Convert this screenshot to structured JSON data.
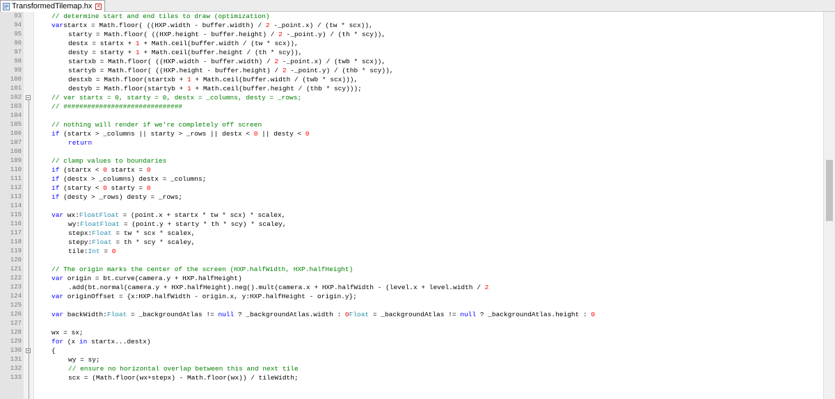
{
  "tab": {
    "filename": "TransformedTilemap.hx"
  },
  "lines": [
    {
      "n": "93",
      "i": 2,
      "t": [
        [
          "c",
          "// determine start and end tiles to draw (optimization)"
        ]
      ]
    },
    {
      "n": "94",
      "i": 2,
      "t": [
        [
          "k",
          "var"
        ],
        [
          "",
          "startx = Math.floor( ((HXP.width - buffer.width) / "
        ],
        [
          "n",
          "2"
        ],
        [
          "",
          " -_point.x) / (tw * scx)),"
        ]
      ]
    },
    {
      "n": "95",
      "i": 3,
      "t": [
        [
          "",
          "starty = Math.floor( ((HXP.height - buffer.height) / "
        ],
        [
          "n",
          "2"
        ],
        [
          "",
          " -_point.y) / (th * scy)),"
        ]
      ]
    },
    {
      "n": "96",
      "i": 3,
      "t": [
        [
          "",
          "destx = startx + "
        ],
        [
          "n",
          "1"
        ],
        [
          "",
          " + Math.ceil(buffer.width / (tw * scx)),"
        ]
      ]
    },
    {
      "n": "97",
      "i": 3,
      "t": [
        [
          "",
          "desty = starty + "
        ],
        [
          "n",
          "1"
        ],
        [
          "",
          " + Math.ceil(buffer.height / (th * scy)),"
        ]
      ]
    },
    {
      "n": "98",
      "i": 3,
      "t": [
        [
          "",
          "startxb = Math.floor( ((HXP.width - buffer.width) / "
        ],
        [
          "n",
          "2"
        ],
        [
          "",
          " -_point.x) / (twb * scx)),"
        ]
      ]
    },
    {
      "n": "99",
      "i": 3,
      "t": [
        [
          "",
          "startyb = Math.floor( ((HXP.height - buffer.height) / "
        ],
        [
          "n",
          "2"
        ],
        [
          "",
          " -_point.y) / (thb * scy)),"
        ]
      ]
    },
    {
      "n": "100",
      "i": 3,
      "t": [
        [
          "",
          "destxb = Math.floor(startxb + "
        ],
        [
          "n",
          "1"
        ],
        [
          "",
          " + Math.ceil(buffer.width / (twb * scx))),"
        ]
      ]
    },
    {
      "n": "101",
      "i": 3,
      "t": [
        [
          "",
          "destyb = Math.floor(startyb + "
        ],
        [
          "n",
          "1"
        ],
        [
          "",
          " + Math.ceil(buffer.height / (thb * scy)));"
        ]
      ]
    },
    {
      "n": "102",
      "i": 2,
      "t": [
        [
          "c",
          "// var startx = 0, starty = 0, destx = _columns, desty = _rows;"
        ]
      ]
    },
    {
      "n": "103",
      "i": 2,
      "t": [
        [
          "c",
          "// ##############################"
        ]
      ]
    },
    {
      "n": "104",
      "i": 0,
      "t": []
    },
    {
      "n": "105",
      "i": 2,
      "t": [
        [
          "c",
          "// nothing will render if we're completely off screen"
        ]
      ]
    },
    {
      "n": "106",
      "i": 2,
      "t": [
        [
          "k",
          "if"
        ],
        [
          "",
          " (startx > _columns || starty > _rows || destx < "
        ],
        [
          "n",
          "0"
        ],
        [
          "",
          " || desty < "
        ],
        [
          "n",
          "0"
        ],
        [
          ")"
        ]
      ]
    },
    {
      "n": "107",
      "i": 3,
      "t": [
        [
          "k",
          "return"
        ],
        [
          ";"
        ]
      ]
    },
    {
      "n": "108",
      "i": 0,
      "t": []
    },
    {
      "n": "109",
      "i": 2,
      "t": [
        [
          "c",
          "// clamp values to boundaries"
        ]
      ]
    },
    {
      "n": "110",
      "i": 2,
      "t": [
        [
          "k",
          "if"
        ],
        [
          "",
          " (startx < "
        ],
        [
          "n",
          "0"
        ],
        [
          "",
          " startx = "
        ],
        [
          "n",
          "0"
        ],
        [
          ";"
        ]
      ]
    },
    {
      "n": "111",
      "i": 2,
      "t": [
        [
          "k",
          "if"
        ],
        [
          "",
          " (destx > _columns) destx = _columns;"
        ]
      ]
    },
    {
      "n": "112",
      "i": 2,
      "t": [
        [
          "k",
          "if"
        ],
        [
          "",
          " (starty < "
        ],
        [
          "n",
          "0"
        ],
        [
          "",
          " starty = "
        ],
        [
          "n",
          "0"
        ],
        [
          ";"
        ]
      ]
    },
    {
      "n": "113",
      "i": 2,
      "t": [
        [
          "k",
          "if"
        ],
        [
          "",
          " (desty > _rows) desty = _rows;"
        ]
      ]
    },
    {
      "n": "114",
      "i": 0,
      "t": []
    },
    {
      "n": "115",
      "i": 2,
      "t": [
        [
          "k",
          "var"
        ],
        [
          "",
          " wx:"
        ],
        [
          "t",
          "Float"
        ],
        [
          ", sx:"
        ],
        [
          "t",
          "Float"
        ],
        [
          "",
          " = (point.x + startx * tw * scx) * scalex,"
        ]
      ]
    },
    {
      "n": "116",
      "i": 3,
      "t": [
        [
          "",
          "wy:"
        ],
        [
          "t",
          "Float"
        ],
        [
          ", sy:"
        ],
        [
          "t",
          "Float"
        ],
        [
          "",
          " = (point.y + starty * th * scy) * scaley,"
        ]
      ]
    },
    {
      "n": "117",
      "i": 3,
      "t": [
        [
          "",
          "stepx:"
        ],
        [
          "t",
          "Float"
        ],
        [
          "",
          " = tw * scx * scalex,"
        ]
      ]
    },
    {
      "n": "118",
      "i": 3,
      "t": [
        [
          "",
          "stepy:"
        ],
        [
          "t",
          "Float"
        ],
        [
          "",
          " = th * scy * scaley,"
        ]
      ]
    },
    {
      "n": "119",
      "i": 3,
      "t": [
        [
          "",
          "tile:"
        ],
        [
          "t",
          "Int"
        ],
        [
          "",
          " = "
        ],
        [
          "n",
          "0"
        ],
        [
          ";"
        ]
      ]
    },
    {
      "n": "120",
      "i": 0,
      "t": []
    },
    {
      "n": "121",
      "i": 2,
      "t": [
        [
          "c",
          "// The origin marks the center of the screen (HXP.halfWidth, HXP.halfHeight)"
        ]
      ]
    },
    {
      "n": "122",
      "i": 2,
      "t": [
        [
          "k",
          "var"
        ],
        [
          "",
          " origin = bt.curve(camera.y + HXP.halfHeight)"
        ]
      ]
    },
    {
      "n": "123",
      "i": 3,
      "t": [
        [
          "",
          ".add(bt.normal(camera.y + HXP.halfHeight).neg().mult(camera.x + HXP.halfWidth - (level.x + level.width / "
        ],
        [
          "n",
          "2"
        ],
        [
          ")));"
        ]
      ]
    },
    {
      "n": "124",
      "i": 2,
      "t": [
        [
          "k",
          "var"
        ],
        [
          "",
          " originOffset = {x:HXP.halfWidth - origin.x, y:HXP.halfHeight - origin.y};"
        ]
      ]
    },
    {
      "n": "125",
      "i": 0,
      "t": []
    },
    {
      "n": "126",
      "i": 2,
      "t": [
        [
          "k",
          "var"
        ],
        [
          "",
          " backWidth:"
        ],
        [
          "t",
          "Float"
        ],
        [
          "",
          " = _backgroundAtlas != "
        ],
        [
          "k",
          "null"
        ],
        [
          "",
          " ? _backgroundAtlas.width : "
        ],
        [
          "n",
          "0"
        ],
        [
          ", backHeight:"
        ],
        [
          "t",
          "Float"
        ],
        [
          "",
          " = _backgroundAtlas != "
        ],
        [
          "k",
          "null"
        ],
        [
          "",
          " ? _backgroundAtlas.height : "
        ],
        [
          "n",
          "0"
        ],
        [
          ";"
        ]
      ]
    },
    {
      "n": "127",
      "i": 0,
      "t": []
    },
    {
      "n": "128",
      "i": 2,
      "t": [
        [
          "",
          "wx = sx;"
        ]
      ]
    },
    {
      "n": "129",
      "i": 2,
      "t": [
        [
          "k",
          "for"
        ],
        [
          "",
          " (x "
        ],
        [
          "k",
          "in"
        ],
        [
          "",
          " startx...destx)"
        ]
      ]
    },
    {
      "n": "130",
      "i": 2,
      "t": [
        [
          "",
          "{"
        ]
      ]
    },
    {
      "n": "131",
      "i": 3,
      "t": [
        [
          "",
          "wy = sy;"
        ]
      ]
    },
    {
      "n": "132",
      "i": 3,
      "t": [
        [
          "c",
          "// ensure no horizontal overlap between this and next tile"
        ]
      ]
    },
    {
      "n": "133",
      "i": 3,
      "t": [
        [
          "",
          "scx = (Math.floor(wx+stepx) - Math.floor(wx)) / tileWidth;"
        ]
      ]
    }
  ]
}
